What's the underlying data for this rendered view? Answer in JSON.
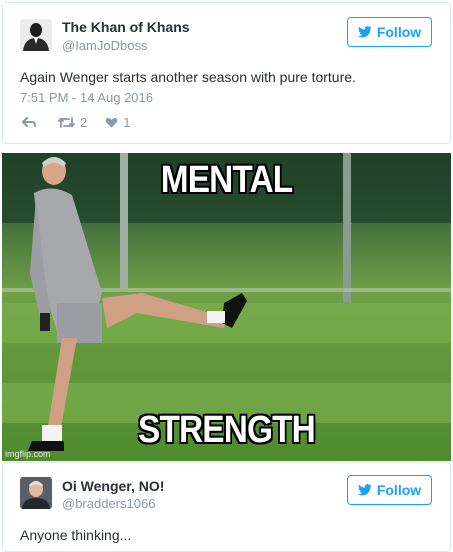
{
  "tweets": [
    {
      "name": "The Khan of Khans",
      "handle": "@IamJoDboss",
      "follow_label": "Follow",
      "text": "Again Wenger starts another season with pure torture.",
      "timestamp": "7:51 PM - 14 Aug 2016",
      "retweets": "2",
      "likes": "1"
    },
    {
      "name": "Oi Wenger, NO!",
      "handle": "@bradders1066",
      "follow_label": "Follow",
      "text": "Anyone thinking..."
    }
  ],
  "meme": {
    "top_text": "MENTAL",
    "bottom_text": "STRENGTH",
    "watermark": "imgflip.com"
  },
  "colors": {
    "accent": "#1da1f2",
    "muted": "#8899a6",
    "text": "#292f33"
  }
}
